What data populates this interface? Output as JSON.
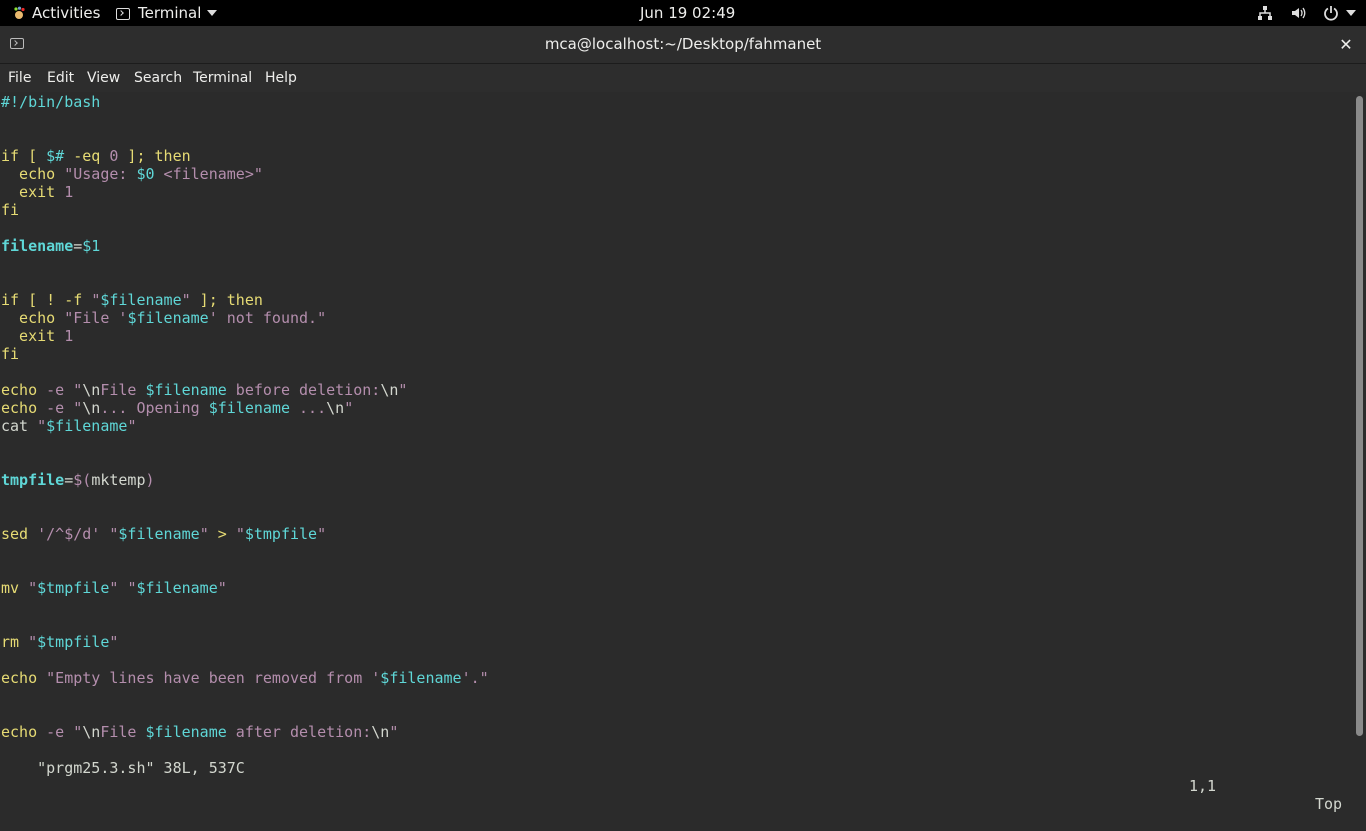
{
  "topbar": {
    "activities": "Activities",
    "app_menu": "Terminal",
    "clock": "Jun 19  02:49",
    "tray_icons": [
      "network-icon",
      "volume-icon",
      "power-icon"
    ]
  },
  "window": {
    "title": "mca@localhost:~/Desktop/fahmanet"
  },
  "menu": {
    "items": [
      "File",
      "Edit",
      "View",
      "Search",
      "Terminal",
      "Help"
    ]
  },
  "editor": {
    "lines": [
      [
        {
          "t": "#!/bin/bash",
          "c": "c"
        }
      ],
      [],
      [],
      [
        {
          "t": "if [ ",
          "c": "k"
        },
        {
          "t": "$#",
          "c": "c"
        },
        {
          "t": " -eq ",
          "c": "k"
        },
        {
          "t": "0",
          "c": "s"
        },
        {
          "t": " ]; then",
          "c": "k"
        }
      ],
      [
        {
          "t": "  echo ",
          "c": "k"
        },
        {
          "t": "\"Usage: ",
          "c": "s"
        },
        {
          "t": "$0",
          "c": "c"
        },
        {
          "t": " <filename>\"",
          "c": "s"
        }
      ],
      [
        {
          "t": "  exit ",
          "c": "k"
        },
        {
          "t": "1",
          "c": "s"
        }
      ],
      [
        {
          "t": "fi",
          "c": "k"
        }
      ],
      [],
      [
        {
          "t": "filename",
          "c": "cb"
        },
        {
          "t": "=",
          "c": "w"
        },
        {
          "t": "$1",
          "c": "c"
        }
      ],
      [],
      [],
      [
        {
          "t": "if [ ! -f ",
          "c": "k"
        },
        {
          "t": "\"",
          "c": "s"
        },
        {
          "t": "$filename",
          "c": "c"
        },
        {
          "t": "\"",
          "c": "s"
        },
        {
          "t": " ]; then",
          "c": "k"
        }
      ],
      [
        {
          "t": "  echo ",
          "c": "k"
        },
        {
          "t": "\"File '",
          "c": "s"
        },
        {
          "t": "$filename",
          "c": "c"
        },
        {
          "t": "' not found.\"",
          "c": "s"
        }
      ],
      [
        {
          "t": "  exit ",
          "c": "k"
        },
        {
          "t": "1",
          "c": "s"
        }
      ],
      [
        {
          "t": "fi",
          "c": "k"
        }
      ],
      [],
      [
        {
          "t": "echo ",
          "c": "k"
        },
        {
          "t": "-e ",
          "c": "s"
        },
        {
          "t": "\"",
          "c": "s"
        },
        {
          "t": "\\n",
          "c": "w"
        },
        {
          "t": "File ",
          "c": "s"
        },
        {
          "t": "$filename",
          "c": "c"
        },
        {
          "t": " before deletion:",
          "c": "s"
        },
        {
          "t": "\\n",
          "c": "w"
        },
        {
          "t": "\"",
          "c": "s"
        }
      ],
      [
        {
          "t": "echo ",
          "c": "k"
        },
        {
          "t": "-e ",
          "c": "s"
        },
        {
          "t": "\"",
          "c": "s"
        },
        {
          "t": "\\n",
          "c": "w"
        },
        {
          "t": "... Opening ",
          "c": "s"
        },
        {
          "t": "$filename",
          "c": "c"
        },
        {
          "t": " ...",
          "c": "s"
        },
        {
          "t": "\\n",
          "c": "w"
        },
        {
          "t": "\"",
          "c": "s"
        }
      ],
      [
        {
          "t": "cat ",
          "c": "w"
        },
        {
          "t": "\"",
          "c": "s"
        },
        {
          "t": "$filename",
          "c": "c"
        },
        {
          "t": "\"",
          "c": "s"
        }
      ],
      [],
      [],
      [
        {
          "t": "tmpfile",
          "c": "cb"
        },
        {
          "t": "=",
          "c": "w"
        },
        {
          "t": "$(",
          "c": "s"
        },
        {
          "t": "mktemp",
          "c": "w"
        },
        {
          "t": ")",
          "c": "s"
        }
      ],
      [],
      [],
      [
        {
          "t": "sed ",
          "c": "k"
        },
        {
          "t": "'/^$/d'",
          "c": "s"
        },
        {
          "t": " ",
          "c": "w"
        },
        {
          "t": "\"",
          "c": "s"
        },
        {
          "t": "$filename",
          "c": "c"
        },
        {
          "t": "\"",
          "c": "s"
        },
        {
          "t": " > ",
          "c": "k"
        },
        {
          "t": "\"",
          "c": "s"
        },
        {
          "t": "$tmpfile",
          "c": "c"
        },
        {
          "t": "\"",
          "c": "s"
        }
      ],
      [],
      [],
      [
        {
          "t": "mv ",
          "c": "k"
        },
        {
          "t": "\"",
          "c": "s"
        },
        {
          "t": "$tmpfile",
          "c": "c"
        },
        {
          "t": "\"",
          "c": "s"
        },
        {
          "t": " ",
          "c": "w"
        },
        {
          "t": "\"",
          "c": "s"
        },
        {
          "t": "$filename",
          "c": "c"
        },
        {
          "t": "\"",
          "c": "s"
        }
      ],
      [],
      [],
      [
        {
          "t": "rm ",
          "c": "k"
        },
        {
          "t": "\"",
          "c": "s"
        },
        {
          "t": "$tmpfile",
          "c": "c"
        },
        {
          "t": "\"",
          "c": "s"
        }
      ],
      [],
      [
        {
          "t": "echo ",
          "c": "k"
        },
        {
          "t": "\"Empty lines have been removed from '",
          "c": "s"
        },
        {
          "t": "$filename",
          "c": "c"
        },
        {
          "t": "'.\"",
          "c": "s"
        }
      ],
      [],
      [],
      [
        {
          "t": "echo ",
          "c": "k"
        },
        {
          "t": "-e ",
          "c": "s"
        },
        {
          "t": "\"",
          "c": "s"
        },
        {
          "t": "\\n",
          "c": "w"
        },
        {
          "t": "File ",
          "c": "s"
        },
        {
          "t": "$filename",
          "c": "c"
        },
        {
          "t": " after deletion:",
          "c": "s"
        },
        {
          "t": "\\n",
          "c": "w"
        },
        {
          "t": "\"",
          "c": "s"
        }
      ]
    ],
    "status_file": "\"prgm25.3.sh\" 38L, 537C",
    "status_position": "1,1",
    "status_scroll": "Top"
  }
}
